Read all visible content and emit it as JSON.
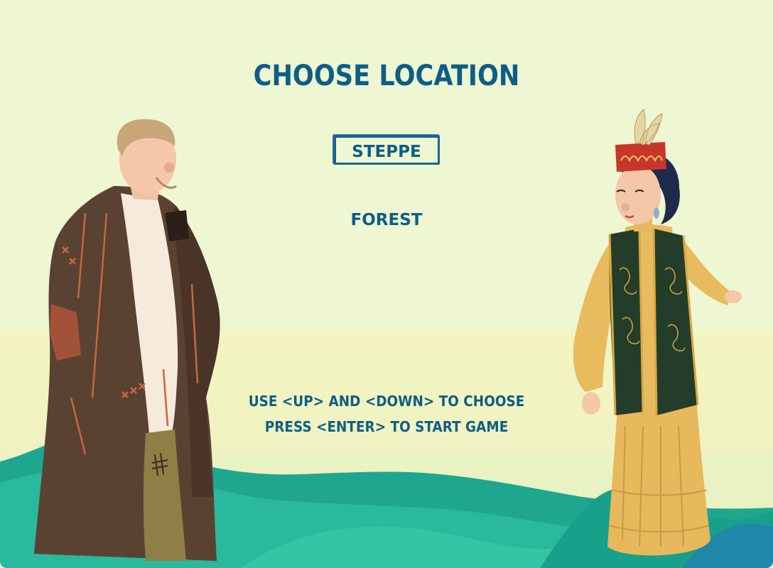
{
  "screen": {
    "title": "CHOOSE LOCATION",
    "menu": {
      "options": [
        "STEPPE",
        "FOREST"
      ],
      "selected": "STEPPE"
    },
    "instructions": {
      "line1": "USE <UP> AND <DOWN> TO CHOOSE",
      "line2": "PRESS <ENTER> TO START GAME"
    }
  },
  "colors": {
    "text": "#0d5e86",
    "background": "#eef6d2",
    "hills_dark": "#1ca88f",
    "hills_light": "#2fc2a4"
  }
}
